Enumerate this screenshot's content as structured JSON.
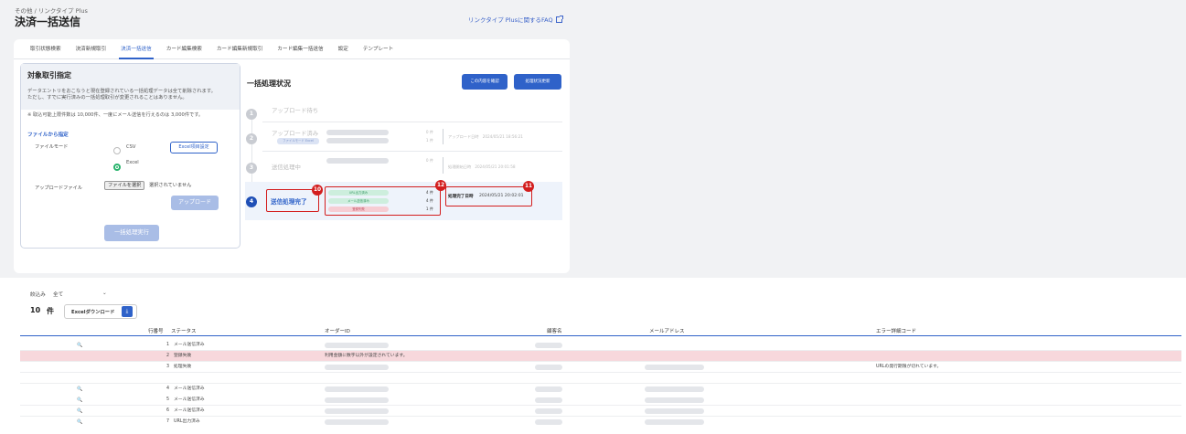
{
  "header": {
    "breadcrumb": "その他 / リンクタイプ Plus",
    "title": "決済一括送信",
    "faq_link": "リンクタイプ Plusに関するFAQ"
  },
  "tabs": [
    "取引状態検索",
    "決済新規取引",
    "決済一括送信",
    "カード編集検索",
    "カード編集新規取引",
    "カード編集一括送信",
    "設定",
    "テンプレート"
  ],
  "active_tab": "決済一括送信",
  "left_panel": {
    "title": "対象取引指定",
    "desc1": "データエントリをおこなうと現在登録されている一括処理データは全て削除されます。",
    "desc2": "ただし、すでに実行済みの一括処理取引が変更されることはありません。",
    "note": "※ 取込可能上限件数は 10,000件、一度にメール送信を行えるのは 3,000件です。",
    "file_section": "ファイルから指定",
    "file_mode_label": "ファイルモード",
    "options": [
      "CSV",
      "Excel"
    ],
    "selected_option": "Excel",
    "excel_settings_button": "Excel項目設定",
    "upload_file_label": "アップロードファイル",
    "choose_file_button": "ファイルを選択",
    "no_file_text": "選択されていません",
    "upload_button": "アップロード",
    "execute_button": "一括処理実行"
  },
  "right_panel": {
    "title": "一括処理状況",
    "confirm_button": "この内容を確認",
    "refresh_button": "処理状況更新",
    "steps": [
      {
        "num": "1",
        "label": "アップロード待ち"
      },
      {
        "num": "2",
        "label": "アップロード済み",
        "sub_badge": "ファイルモード Excel",
        "counts": [
          "0 件",
          "1 件"
        ],
        "meta": "アップロード日時　2024/05/21 18:56:21"
      },
      {
        "num": "3",
        "label": "送信処理中",
        "counts": [
          "0 件"
        ],
        "meta": "処理開始日時　2024/05/21 20:01:58"
      },
      {
        "num": "4",
        "label": "送信処理完了",
        "pills": [
          "URL出力済み",
          "メール送信済み",
          "登録失敗"
        ],
        "counts": [
          "4 件",
          "4 件",
          "1 件"
        ],
        "meta_label": "処理完了日時",
        "meta_value": "2024/05/21 20:02:01"
      }
    ],
    "callouts": [
      "10",
      "11",
      "12"
    ]
  },
  "table": {
    "filter_label": "絞込み",
    "filter_value": "全て",
    "count": "10",
    "count_unit": "件",
    "download_button": "Excelダウンロード",
    "columns": [
      "行番号",
      "ステータス",
      "オーダーID",
      "顧客名",
      "メールアドレス",
      "エラー詳細コード"
    ],
    "rows": [
      {
        "no": "1",
        "status": "メール送信済み",
        "error": ""
      },
      {
        "no": "2",
        "status": "登録失敗",
        "order_id": "利用金額に数字以外が設定されています。",
        "error": ""
      },
      {
        "no": "3",
        "status": "処理失敗",
        "error": "URLの発行期限が切れています。"
      },
      {
        "no": "4",
        "status": "メール送信済み",
        "error": ""
      },
      {
        "no": "5",
        "status": "メール送信済み",
        "error": ""
      },
      {
        "no": "6",
        "status": "メール送信済み",
        "error": ""
      },
      {
        "no": "7",
        "status": "URL出力済み",
        "error": ""
      }
    ]
  },
  "colors": {
    "accent": "#2f62c9",
    "highlight": "#d31e1e",
    "success": "#27b36b",
    "error_row": "#f7d8dc"
  }
}
